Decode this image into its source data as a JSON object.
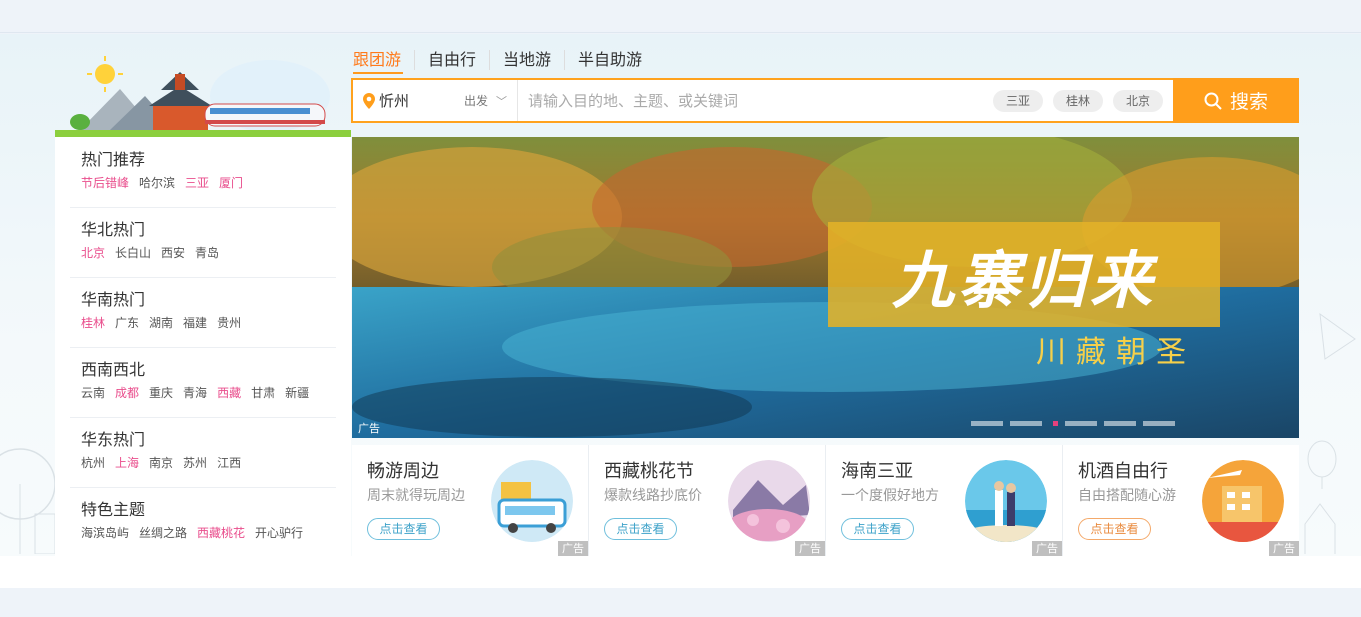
{
  "sidebar": {
    "groups": [
      {
        "title": "热门推荐",
        "links": [
          {
            "label": "节后错峰",
            "hot": true
          },
          {
            "label": "哈尔滨",
            "hot": false
          },
          {
            "label": "三亚",
            "hot": true
          },
          {
            "label": "厦门",
            "hot": true
          }
        ]
      },
      {
        "title": "华北热门",
        "links": [
          {
            "label": "北京",
            "hot": true
          },
          {
            "label": "长白山",
            "hot": false
          },
          {
            "label": "西安",
            "hot": false
          },
          {
            "label": "青岛",
            "hot": false
          }
        ]
      },
      {
        "title": "华南热门",
        "links": [
          {
            "label": "桂林",
            "hot": true
          },
          {
            "label": "广东",
            "hot": false
          },
          {
            "label": "湖南",
            "hot": false
          },
          {
            "label": "福建",
            "hot": false
          },
          {
            "label": "贵州",
            "hot": false
          }
        ]
      },
      {
        "title": "西南西北",
        "links": [
          {
            "label": "云南",
            "hot": false
          },
          {
            "label": "成都",
            "hot": true
          },
          {
            "label": "重庆",
            "hot": false
          },
          {
            "label": "青海",
            "hot": false
          },
          {
            "label": "西藏",
            "hot": true
          },
          {
            "label": "甘肃",
            "hot": false
          },
          {
            "label": "新疆",
            "hot": false
          }
        ]
      },
      {
        "title": "华东热门",
        "links": [
          {
            "label": "杭州",
            "hot": false
          },
          {
            "label": "上海",
            "hot": true
          },
          {
            "label": "南京",
            "hot": false
          },
          {
            "label": "苏州",
            "hot": false
          },
          {
            "label": "江西",
            "hot": false
          }
        ]
      },
      {
        "title": "特色主题",
        "links": [
          {
            "label": "海滨岛屿",
            "hot": false
          },
          {
            "label": "丝绸之路",
            "hot": false
          },
          {
            "label": "西藏桃花",
            "hot": true
          },
          {
            "label": "开心驴行",
            "hot": false
          }
        ]
      }
    ]
  },
  "tabs": [
    "跟团游",
    "自由行",
    "当地游",
    "半自助游"
  ],
  "search": {
    "city": "忻州",
    "depart_label": "出发",
    "placeholder": "请输入目的地、主题、或关键词",
    "chips": [
      "三亚",
      "桂林",
      "北京"
    ],
    "button_label": "搜索"
  },
  "banner": {
    "title": "九寨归来",
    "subtitle": "川藏朝圣",
    "ad_label": "广告",
    "dot_count": 6,
    "active_dot": 2
  },
  "cards": [
    {
      "title": "畅游周边",
      "subtitle": "周末就得玩周边",
      "button": "点击查看",
      "ad": "广告"
    },
    {
      "title": "西藏桃花节",
      "subtitle": "爆款线路抄底价",
      "button": "点击查看",
      "ad": "广告"
    },
    {
      "title": "海南三亚",
      "subtitle": "一个度假好地方",
      "button": "点击查看",
      "ad": "广告"
    },
    {
      "title": "机酒自由行",
      "subtitle": "自由搭配随心游",
      "button": "点击查看",
      "ad": "广告"
    }
  ],
  "colors": {
    "accent": "#ff9e1b",
    "hot_link": "#e94d8c",
    "active_tab": "#ff7a1a"
  }
}
